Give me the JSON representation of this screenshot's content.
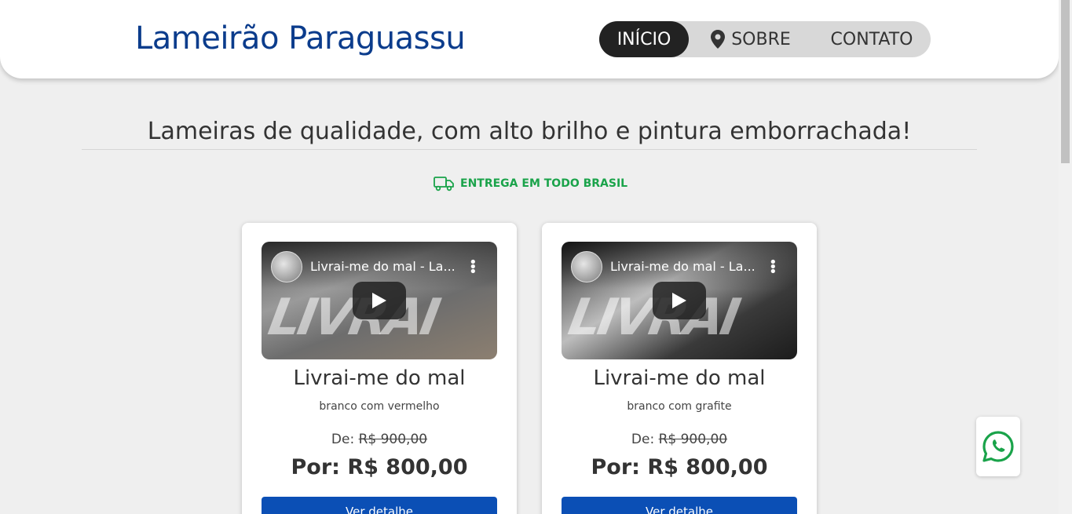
{
  "header": {
    "brand": "Lameirão Paraguassu",
    "nav": [
      {
        "label": "INÍCIO"
      },
      {
        "label": "SOBRE"
      },
      {
        "label": "CONTATO"
      }
    ]
  },
  "hero": {
    "tagline": "Lameiras de qualidade, com alto brilho e pintura emborrachada!",
    "delivery": "ENTREGA EM TODO BRASIL"
  },
  "products": [
    {
      "video_title": "Livrai-me do mal - La...",
      "title": "Livrai-me do mal",
      "subtitle": "branco com vermelho",
      "de_label": "De:",
      "old_price": "R$ 900,00",
      "new_price": "Por: R$ 800,00",
      "button": "Ver detalhe"
    },
    {
      "video_title": "Livrai-me do mal - La...",
      "title": "Livrai-me do mal",
      "subtitle": "branco com grafite",
      "de_label": "De:",
      "old_price": "R$ 900,00",
      "new_price": "Por: R$ 800,00",
      "button": "Ver detalhe"
    }
  ],
  "colors": {
    "brand": "#0b3c8c",
    "accent_green": "#1aa34a",
    "button_blue": "#0b4fb5",
    "nav_active": "#222222"
  }
}
